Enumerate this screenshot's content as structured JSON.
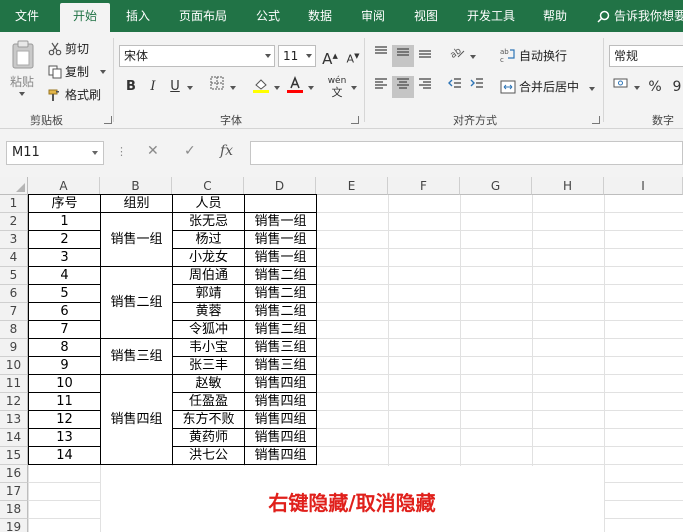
{
  "ribbon": {
    "tabs": [
      {
        "label": "文件",
        "active": false
      },
      {
        "label": "开始",
        "active": true
      },
      {
        "label": "插入",
        "active": false
      },
      {
        "label": "页面布局",
        "active": false
      },
      {
        "label": "公式",
        "active": false
      },
      {
        "label": "数据",
        "active": false
      },
      {
        "label": "审阅",
        "active": false
      },
      {
        "label": "视图",
        "active": false
      },
      {
        "label": "开发工具",
        "active": false
      },
      {
        "label": "帮助",
        "active": false
      }
    ],
    "tell_me": "告诉我你想要",
    "clipboard": {
      "paste": "粘贴",
      "cut": "剪切",
      "copy": "复制",
      "format_painter": "格式刷",
      "group": "剪贴板"
    },
    "font": {
      "name": "宋体",
      "size": "11",
      "bold": "B",
      "italic": "I",
      "underline": "U",
      "grow": "A",
      "shrink": "A",
      "phonetic": "wén",
      "group": "字体"
    },
    "alignment": {
      "wrap_text": "自动换行",
      "merge_center": "合并后居中",
      "group": "对齐方式"
    },
    "number": {
      "format": "常规",
      "percent": "%",
      "group": "数字"
    },
    "colors": {
      "brand": "#217346",
      "fill_swatch": "#ffff00",
      "font_swatch": "#ff0000"
    }
  },
  "formula_bar": {
    "name_box": "M11",
    "cancel": "✕",
    "enter": "✓",
    "fx": "fx",
    "formula": ""
  },
  "sheet": {
    "columns": [
      "A",
      "B",
      "C",
      "D",
      "E",
      "F",
      "G",
      "H",
      "I"
    ],
    "rows": [
      "1",
      "2",
      "3",
      "4",
      "5",
      "6",
      "7",
      "8",
      "9",
      "10",
      "11",
      "12",
      "13",
      "14",
      "15",
      "16",
      "17",
      "18",
      "19"
    ],
    "headers": {
      "a1": "序号",
      "b1": "组别",
      "c1": "人员"
    },
    "a_values": [
      "1",
      "2",
      "3",
      "4",
      "5",
      "6",
      "7",
      "8",
      "9",
      "10",
      "11",
      "12",
      "13",
      "14"
    ],
    "groups": [
      "销售一组",
      "销售二组",
      "销售三组",
      "销售四组"
    ],
    "people": [
      "张无忌",
      "杨过",
      "小龙女",
      "周伯通",
      "郭靖",
      "黄蓉",
      "令狐冲",
      "韦小宝",
      "张三丰",
      "赵敏",
      "任盈盈",
      "东方不败",
      "黄药师",
      "洪七公"
    ],
    "d_values": [
      "销售一组",
      "销售一组",
      "销售一组",
      "销售二组",
      "销售二组",
      "销售二组",
      "销售二组",
      "销售三组",
      "销售三组",
      "销售四组",
      "销售四组",
      "销售四组",
      "销售四组",
      "销售四组"
    ],
    "note": "右键隐藏/取消隐藏",
    "note_color": "#e0201b"
  }
}
